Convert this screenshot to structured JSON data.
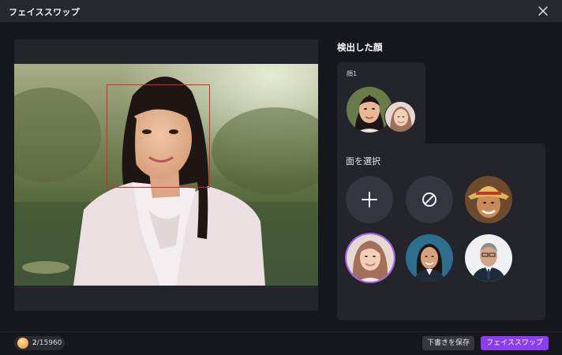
{
  "window": {
    "title": "フェイススワップ",
    "close_icon": "close-icon"
  },
  "preview": {
    "face_box_color": "#e02424"
  },
  "detected": {
    "title": "検出した顔",
    "faces": [
      {
        "label": "顔1"
      }
    ]
  },
  "selection": {
    "title": "面を選択",
    "options": [
      {
        "name": "add-face-button",
        "icon": "plus-icon"
      },
      {
        "name": "no-face-button",
        "icon": "prohibit-icon"
      },
      {
        "name": "face-option-straw-hat"
      },
      {
        "name": "face-option-woman-smiling",
        "selected": true
      },
      {
        "name": "face-option-businesswoman"
      },
      {
        "name": "face-option-businessman"
      }
    ]
  },
  "footer": {
    "credits_used": "2",
    "credits_total": "/15960",
    "save_draft_label": "下書きを保存",
    "face_swap_label": "フェイススワップ"
  },
  "colors": {
    "accent": "#8b3df0",
    "selected_ring": "#a35df0",
    "background": "#16171c",
    "panel": "#24252b"
  }
}
